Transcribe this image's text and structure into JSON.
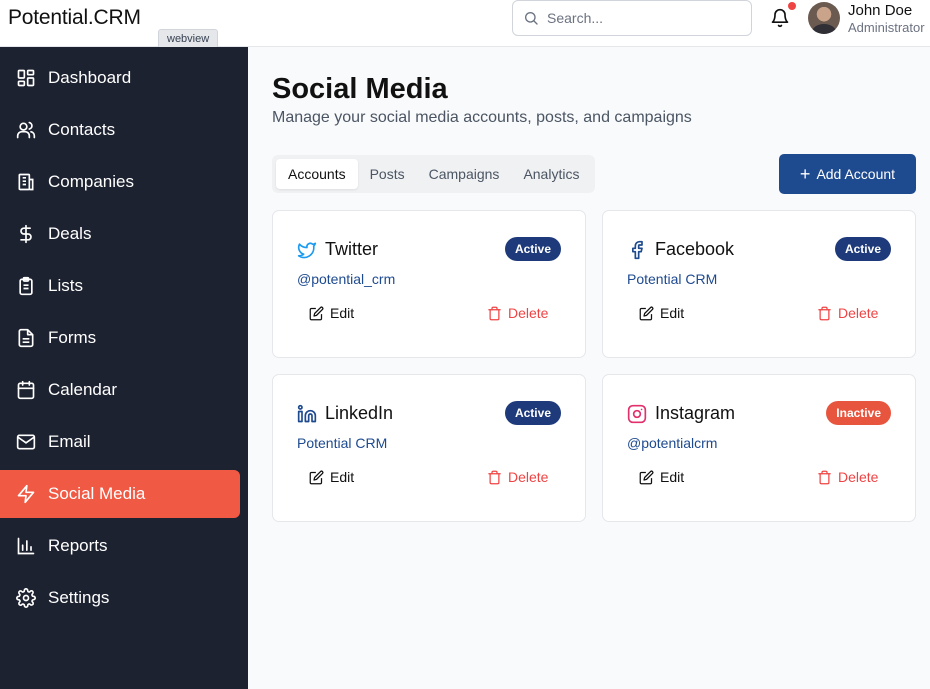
{
  "app": {
    "logo": "Potential.CRM",
    "webview_tag": "webview"
  },
  "search": {
    "placeholder": "Search..."
  },
  "user": {
    "name": "John Doe",
    "role": "Administrator"
  },
  "sidebar": {
    "items": [
      {
        "label": "Dashboard",
        "icon": "dashboard-icon"
      },
      {
        "label": "Contacts",
        "icon": "users-icon"
      },
      {
        "label": "Companies",
        "icon": "building-icon"
      },
      {
        "label": "Deals",
        "icon": "dollar-icon"
      },
      {
        "label": "Lists",
        "icon": "clipboard-list-icon"
      },
      {
        "label": "Forms",
        "icon": "file-text-icon"
      },
      {
        "label": "Calendar",
        "icon": "calendar-icon"
      },
      {
        "label": "Email",
        "icon": "mail-icon"
      },
      {
        "label": "Social Media",
        "icon": "lightning-icon",
        "active": true
      },
      {
        "label": "Reports",
        "icon": "bar-chart-icon"
      },
      {
        "label": "Settings",
        "icon": "gear-icon"
      }
    ]
  },
  "main": {
    "title": "Social Media",
    "subtitle": "Manage your social media accounts, posts, and campaigns",
    "tabs": [
      "Accounts",
      "Posts",
      "Campaigns",
      "Analytics"
    ],
    "active_tab": "Accounts",
    "add_button": "Add Account",
    "accounts": [
      {
        "name": "Twitter",
        "handle": "@potential_crm",
        "status": "Active",
        "icon": "twitter-icon"
      },
      {
        "name": "Facebook",
        "handle": "Potential CRM",
        "status": "Active",
        "icon": "facebook-icon"
      },
      {
        "name": "LinkedIn",
        "handle": "Potential CRM",
        "status": "Active",
        "icon": "linkedin-icon"
      },
      {
        "name": "Instagram",
        "handle": "@potentialcrm",
        "status": "Inactive",
        "icon": "instagram-icon"
      }
    ],
    "edit_label": "Edit",
    "delete_label": "Delete"
  },
  "colors": {
    "sidebar_bg": "#1d2230",
    "accent": "#f05a45",
    "primary": "#1e4a8f",
    "danger": "#ef4444"
  }
}
